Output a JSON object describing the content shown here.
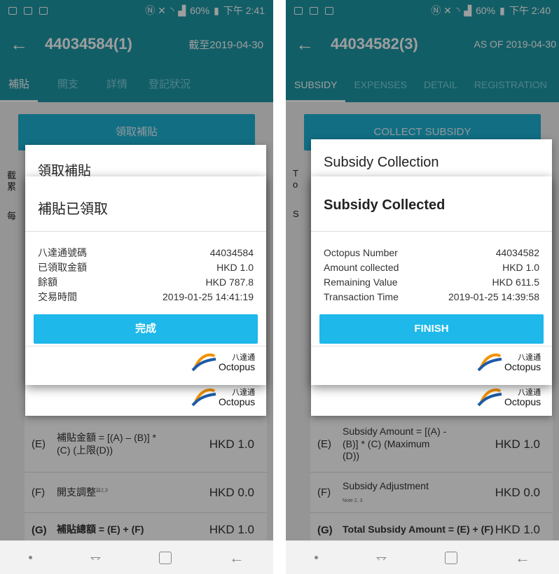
{
  "left": {
    "status": {
      "net": "Ⓝ ✕",
      "battery": "60%",
      "time": "下午 2:41"
    },
    "appbar": {
      "title": "44034584(1)",
      "as_of": "截至2019-04-30"
    },
    "tabs": [
      "補貼",
      "開支",
      "詳情",
      "登記狀況"
    ],
    "collect_button": "領取補貼",
    "under_fragments": [
      "截",
      "累",
      "每"
    ],
    "back_dialog_title": "領取補貼",
    "dialog": {
      "heading": "補貼已領取",
      "rows": [
        {
          "label": "八達通號碼",
          "value": "44034584"
        },
        {
          "label": "已領取金額",
          "value": "HKD 1.0"
        },
        {
          "label": "餘額",
          "value": "HKD 787.8"
        },
        {
          "label": "交易時間",
          "value": "2019-01-25 14:41:19"
        }
      ],
      "finish": "完成"
    },
    "octopus": {
      "cn": "八達通",
      "en": "Octopus"
    },
    "table": [
      {
        "code": "(E)",
        "label": "補貼金額 = [(A) – (B)] * (C) (上限(D))",
        "amount": "HKD 1.0",
        "note": ""
      },
      {
        "code": "(F)",
        "label": "開支調整",
        "amount": "HKD 0.0",
        "note": "註2,3"
      },
      {
        "code": "(G)",
        "label": "補貼總額 = (E) + (F)",
        "amount": "HKD 1.0",
        "note": ""
      }
    ]
  },
  "right": {
    "status": {
      "net": "Ⓝ ✕",
      "battery": "60%",
      "time": "下午 2:40"
    },
    "appbar": {
      "title": "44034582(3)",
      "as_of": "AS OF 2019-04-30"
    },
    "tabs": [
      "SUBSIDY",
      "EXPENSES",
      "DETAIL",
      "REGISTRATION"
    ],
    "collect_button": "COLLECT SUBSIDY",
    "under_fragments": [
      "T",
      "o",
      "S"
    ],
    "back_dialog_title": "Subsidy Collection",
    "dialog": {
      "heading": "Subsidy Collected",
      "rows": [
        {
          "label": "Octopus Number",
          "value": "44034582"
        },
        {
          "label": "Amount collected",
          "value": "HKD 1.0"
        },
        {
          "label": "Remaining Value",
          "value": "HKD 611.5"
        },
        {
          "label": "Transaction Time",
          "value": "2019-01-25 14:39:58"
        }
      ],
      "finish": "FINISH"
    },
    "octopus": {
      "cn": "八達通",
      "en": "Octopus"
    },
    "table": [
      {
        "code": "(E)",
        "label": "Subsidy Amount = [(A) - (B)] * (C) (Maximum (D))",
        "amount": "HKD 1.0",
        "note": ""
      },
      {
        "code": "(F)",
        "label": "Subsidy Adjustment",
        "amount": "HKD 0.0",
        "note": "Note 2, 3"
      },
      {
        "code": "(G)",
        "label": "Total Subsidy Amount = (E) + (F)",
        "amount": "HKD 1.0",
        "note": ""
      }
    ]
  },
  "colors": {
    "header": "#1e98a7",
    "button": "#1eb8ea",
    "octopus_orange": "#f39200",
    "octopus_blue": "#1d5aa8"
  },
  "icons": [
    "back-arrow-icon",
    "gallery-icon",
    "bag-icon",
    "screenshot-icon",
    "nfc-icon",
    "wifi-icon",
    "signal-icon",
    "battery-icon",
    "nav-dot-icon",
    "nav-recent-icon",
    "nav-home-icon",
    "nav-back-icon"
  ]
}
